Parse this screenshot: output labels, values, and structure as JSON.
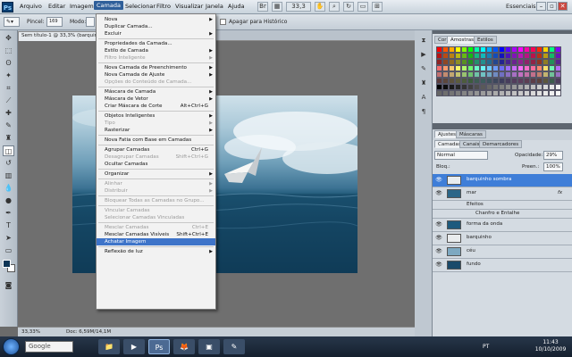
{
  "app": {
    "logo": "Ps",
    "workspace": "Essenciais"
  },
  "menubar": {
    "items": [
      "Arquivo",
      "Editar",
      "Imagem",
      "Camada",
      "Selecionar",
      "Filtro",
      "Visualizar",
      "Janela",
      "Ajuda"
    ],
    "zoom": "33,3",
    "active": "Camada"
  },
  "options": {
    "brush_label": "Pincel:",
    "brush_size": "169",
    "mode_label": "Modo:",
    "history_checkbox": "Apagar para Histórico"
  },
  "document": {
    "tab_label": "Sem título-1 @ 33,3% (barquin"
  },
  "dropdown": {
    "items": [
      {
        "label": "Nova",
        "arrow": true
      },
      {
        "label": "Duplicar Camada..."
      },
      {
        "label": "Excluir",
        "arrow": true
      },
      {
        "sep": true
      },
      {
        "label": "Propriedades da Camada..."
      },
      {
        "label": "Estilo de Camada",
        "arrow": true
      },
      {
        "label": "Filtro Inteligente",
        "disabled": true,
        "arrow": true
      },
      {
        "sep": true
      },
      {
        "label": "Nova Camada de Preenchimento",
        "arrow": true
      },
      {
        "label": "Nova Camada de Ajuste",
        "arrow": true
      },
      {
        "label": "Opções do Conteúdo de Camada...",
        "disabled": true
      },
      {
        "sep": true
      },
      {
        "label": "Máscara de Camada",
        "arrow": true
      },
      {
        "label": "Máscara de Vetor",
        "arrow": true
      },
      {
        "label": "Criar Máscara de Corte",
        "shortcut": "Alt+Ctrl+G"
      },
      {
        "sep": true
      },
      {
        "label": "Objetos Inteligentes",
        "arrow": true
      },
      {
        "label": "Tipo",
        "disabled": true,
        "arrow": true
      },
      {
        "label": "Rasterizar",
        "arrow": true
      },
      {
        "sep": true
      },
      {
        "label": "Nova Fatia com Base em Camadas"
      },
      {
        "sep": true
      },
      {
        "label": "Agrupar Camadas",
        "shortcut": "Ctrl+G"
      },
      {
        "label": "Desagrupar Camadas",
        "shortcut": "Shift+Ctrl+G",
        "disabled": true
      },
      {
        "label": "Ocultar Camadas"
      },
      {
        "sep": true
      },
      {
        "label": "Organizar",
        "arrow": true
      },
      {
        "sep": true
      },
      {
        "label": "Alinhar",
        "disabled": true,
        "arrow": true
      },
      {
        "label": "Distribuir",
        "disabled": true,
        "arrow": true
      },
      {
        "sep": true
      },
      {
        "label": "Bloquear Todas as Camadas no Grupo...",
        "disabled": true
      },
      {
        "sep": true
      },
      {
        "label": "Vincular Camadas",
        "disabled": true
      },
      {
        "label": "Selecionar Camadas Vinculadas",
        "disabled": true
      },
      {
        "sep": true
      },
      {
        "label": "Mesclar Camadas",
        "shortcut": "Ctrl+E",
        "disabled": true
      },
      {
        "label": "Mesclar Camadas Visíveis",
        "shortcut": "Shift+Ctrl+E"
      },
      {
        "label": "Achatar Imagem",
        "highlight": true
      },
      {
        "sep": true
      },
      {
        "label": "Reflexão de luz",
        "arrow": true
      }
    ]
  },
  "panels": {
    "swatch_tabs": [
      "Cor",
      "Amostras",
      "Estilos"
    ],
    "adj_tabs": [
      "Ajustes",
      "Máscaras"
    ],
    "layer_tabs": [
      "Camadas",
      "Canais",
      "Demarcadores"
    ],
    "blend_mode": "Normal",
    "opacity_label": "Opacidade:",
    "opacity_value": "29%",
    "lock_label": "Bloq.:",
    "fill_label": "Preen.:",
    "fill_value": "100%",
    "layers": [
      {
        "name": "barquinho sombra",
        "selected": true
      },
      {
        "name": "mar",
        "fx": "fx"
      },
      {
        "name": "Efeitos",
        "sub": true
      },
      {
        "name": "Chanfro e Entalhe",
        "sub2": true
      },
      {
        "name": "forma da onda"
      },
      {
        "name": "barquinho"
      },
      {
        "name": "céu"
      },
      {
        "name": "fundo"
      }
    ]
  },
  "status": {
    "zoom": "33,33%",
    "doc": "Doc: 6,59M/14,1M"
  },
  "taskbar": {
    "search": "Google",
    "lang": "PT",
    "time": "11:43",
    "date": "10/10/2009"
  },
  "colors": {
    "accent": "#3e74c9",
    "menu_active": "#2f5f9a",
    "foreground": "#0d3556",
    "background": "#ffffff"
  }
}
